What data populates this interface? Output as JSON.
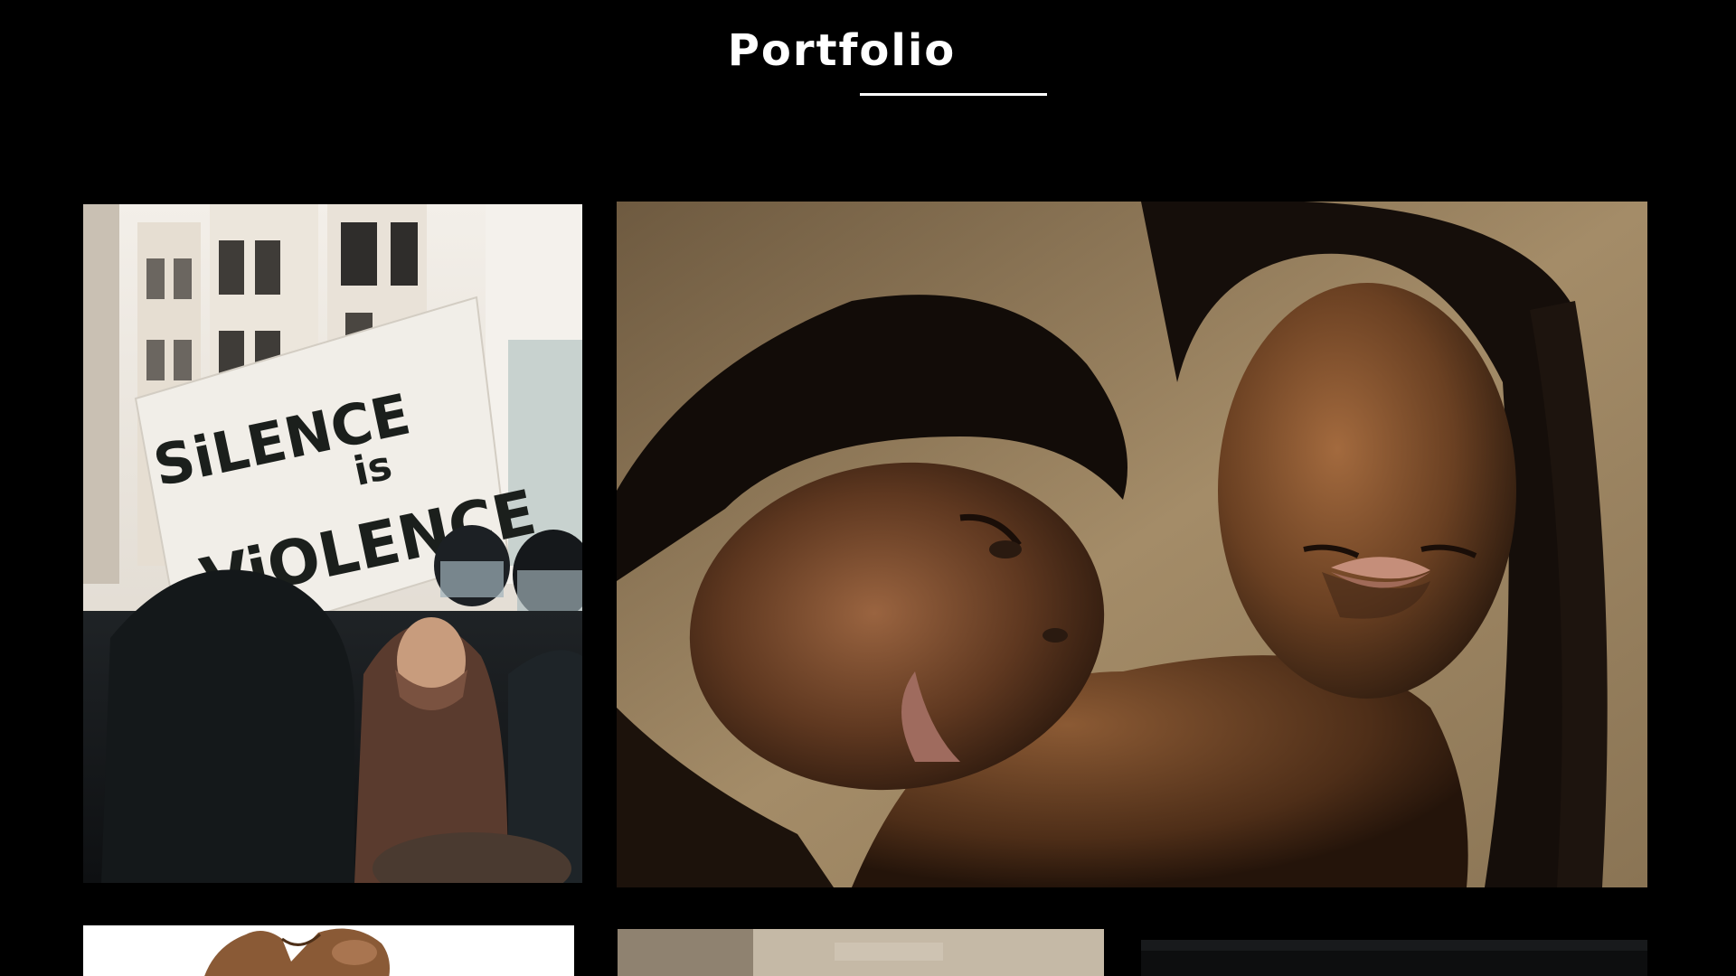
{
  "header": {
    "title": "Portfolio"
  },
  "portfolio": {
    "items": [
      {
        "name": "protest-photo",
        "sign_lines": [
          "SiLENCE",
          "is",
          "ViOLENCE"
        ]
      },
      {
        "name": "two-women-portrait-photo"
      },
      {
        "name": "raised-hands-photo"
      },
      {
        "name": "stone-wall-photo"
      },
      {
        "name": "dark-photo"
      }
    ]
  },
  "colors": {
    "background": "#000000",
    "title": "#ffffff",
    "underline": "#ffffff"
  }
}
